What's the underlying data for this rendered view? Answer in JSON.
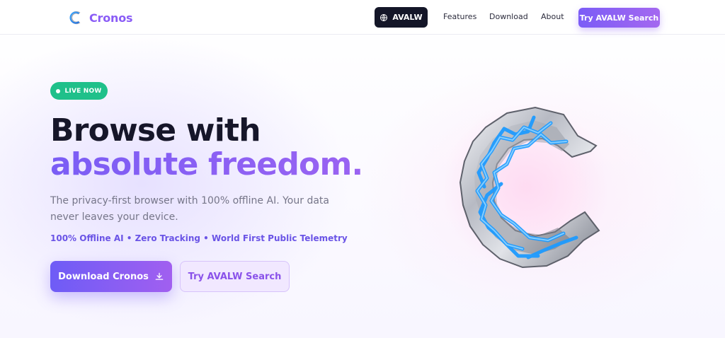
{
  "brand": {
    "name": "Cronos"
  },
  "nav": {
    "pill_label": "AVALW",
    "links": [
      "Features",
      "Download",
      "About"
    ],
    "cta_label": "Try AVALW Search"
  },
  "hero": {
    "badge": "LIVE NOW",
    "headline_line1": "Browse with",
    "headline_line2": "absolute freedom.",
    "subtitle": "The privacy-first browser with 100% offline AI. Your data never leaves your device.",
    "features": "100% Offline AI • Zero Tracking • World First Public Telemetry",
    "primary_button": "Download Cronos",
    "secondary_button": "Try AVALW Search"
  },
  "icons": {
    "globe": "globe-icon",
    "download": "download-icon",
    "logo": "cronos-logo"
  },
  "colors": {
    "accent": "#8a5cf6",
    "badge": "#1fc08a",
    "nav_dark": "#141628",
    "headline": "#161629"
  }
}
